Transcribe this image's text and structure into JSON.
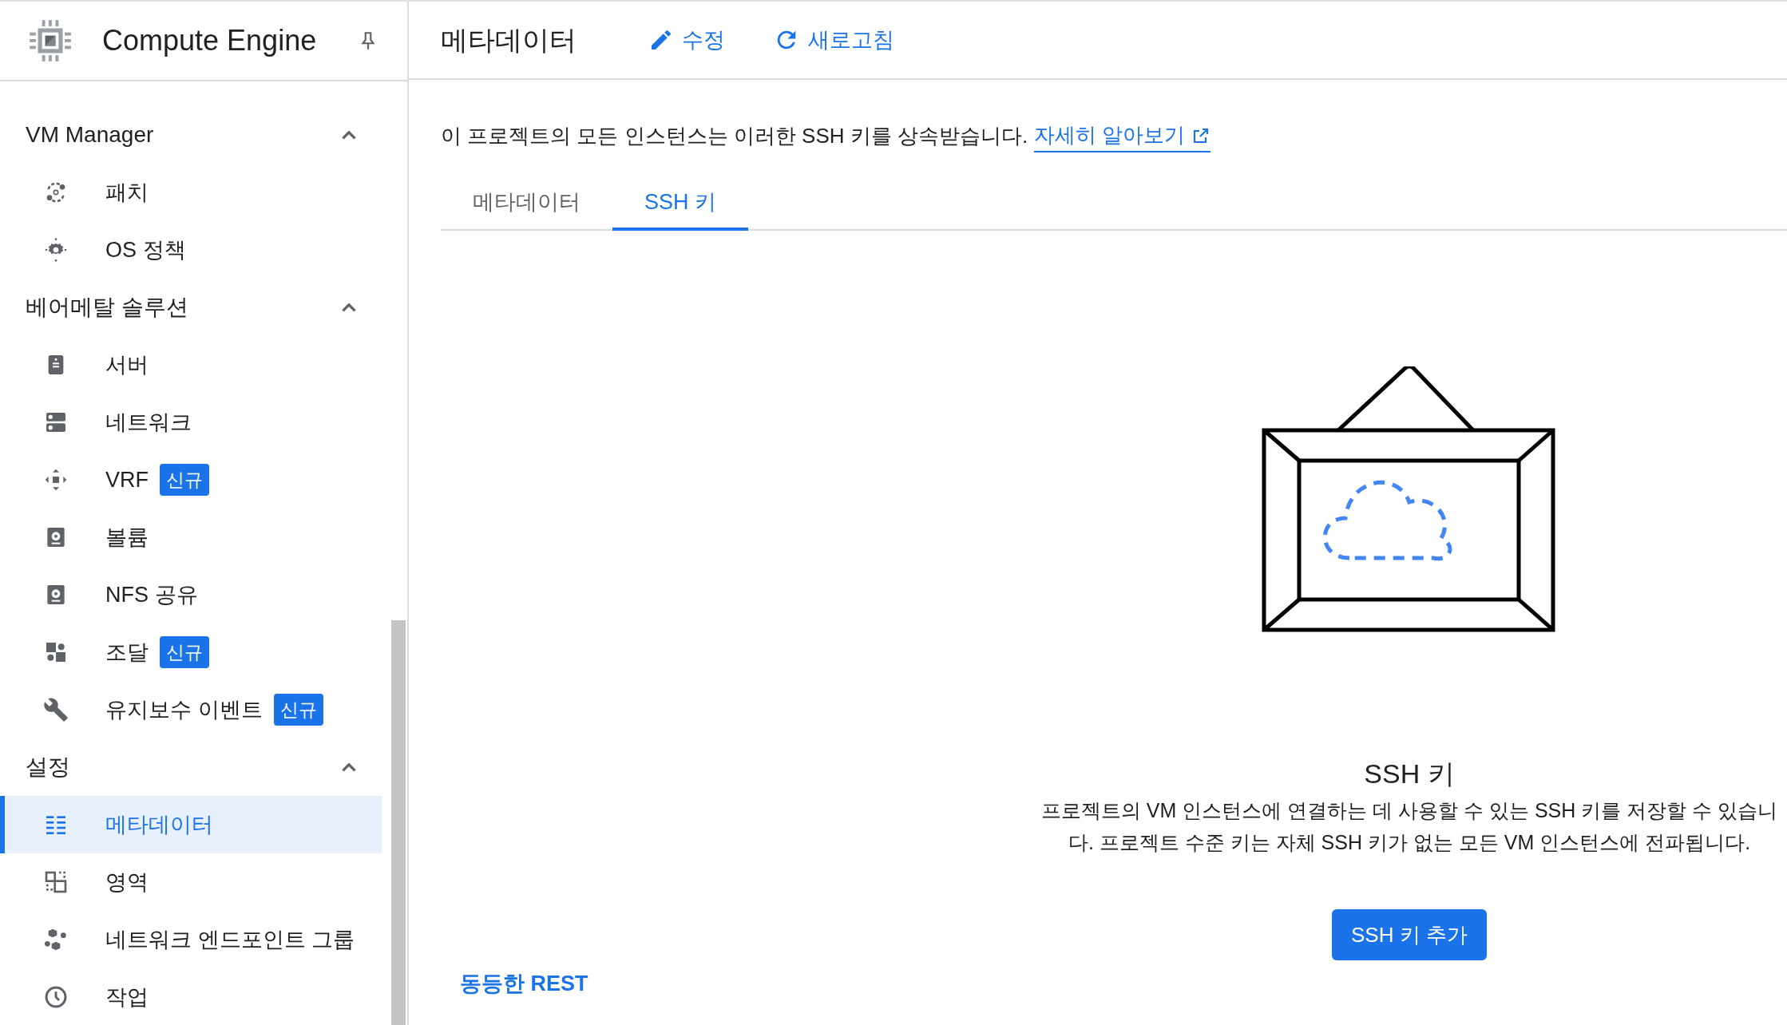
{
  "sidebar": {
    "title": "Compute Engine",
    "sections": [
      {
        "label": "VM Manager",
        "expanded": true,
        "items": [
          {
            "label": "패치",
            "selected": false
          },
          {
            "label": "OS 정책",
            "selected": false
          }
        ]
      },
      {
        "label": "베어메탈 솔루션",
        "expanded": true,
        "items": [
          {
            "label": "서버",
            "selected": false
          },
          {
            "label": "네트워크",
            "selected": false
          },
          {
            "label": "VRF",
            "badge": "신규",
            "selected": false
          },
          {
            "label": "볼륨",
            "selected": false
          },
          {
            "label": "NFS 공유",
            "selected": false
          },
          {
            "label": "조달",
            "badge": "신규",
            "selected": false
          },
          {
            "label": "유지보수 이벤트",
            "badge": "신규",
            "selected": false
          }
        ]
      },
      {
        "label": "설정",
        "expanded": true,
        "items": [
          {
            "label": "메타데이터",
            "selected": true
          },
          {
            "label": "영역",
            "selected": false
          },
          {
            "label": "네트워크 엔드포인트 그룹",
            "selected": false
          },
          {
            "label": "작업",
            "selected": false
          }
        ]
      }
    ]
  },
  "header": {
    "title": "메타데이터",
    "actions": [
      {
        "label": "수정"
      },
      {
        "label": "새로고침"
      }
    ]
  },
  "notice": {
    "text": "이 프로젝트의 모든 인스턴스는 이러한 SSH 키를 상속받습니다.",
    "link": "자세히 알아보기"
  },
  "tabs": [
    {
      "label": "메타데이터",
      "selected": false
    },
    {
      "label": "SSH 키",
      "selected": true
    }
  ],
  "empty_state": {
    "title": "SSH 키",
    "description": "프로젝트의 VM 인스턴스에 연결하는 데 사용할 수 있는 SSH 키를 저장할 수 있습니다. 프로젝트 수준 키는 자체 SSH 키가 없는 모든 VM 인스턴스에 전파됩니다.",
    "button": "SSH 키 추가"
  },
  "rest_link": "동등한 REST"
}
